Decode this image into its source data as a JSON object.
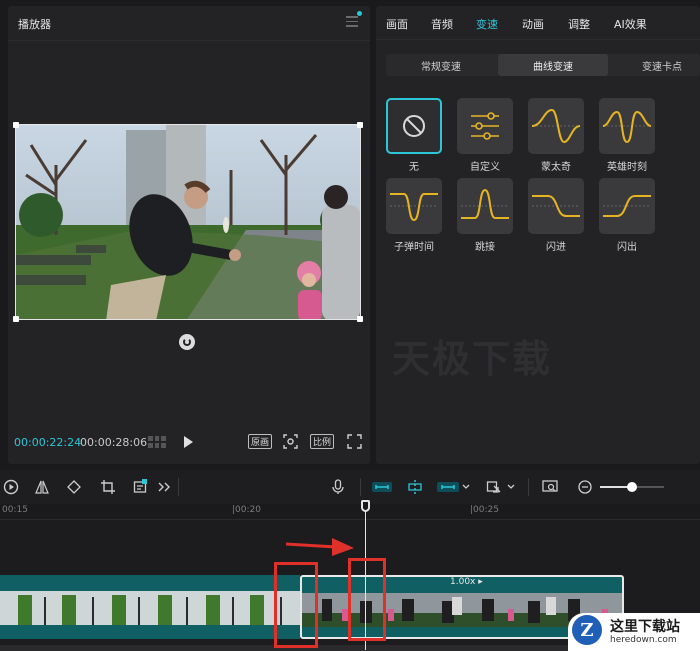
{
  "player": {
    "title": "播放器",
    "time_current": "00:00:22:24",
    "time_total": "00:00:28:06",
    "btn_fullframe": "原画",
    "btn_ratio": "比例"
  },
  "right_panel": {
    "tabs": [
      "画面",
      "音频",
      "变速",
      "动画",
      "调整",
      "AI效果"
    ],
    "active_tab": "变速",
    "subtabs": [
      "常规变速",
      "曲线变速",
      "变速卡点"
    ],
    "active_subtab": "曲线变速",
    "curves": [
      {
        "label": "无",
        "icon": "none-icon"
      },
      {
        "label": "自定义",
        "icon": "custom-sliders-icon"
      },
      {
        "label": "蒙太奇",
        "icon": "montage-curve-icon"
      },
      {
        "label": "英雄时刻",
        "icon": "hero-moment-curve-icon"
      },
      {
        "label": "子弹时间",
        "icon": "bullet-time-curve-icon"
      },
      {
        "label": "跳接",
        "icon": "jump-cut-curve-icon"
      },
      {
        "label": "闪进",
        "icon": "flash-in-curve-icon"
      },
      {
        "label": "闪出",
        "icon": "flash-out-curve-icon"
      }
    ],
    "watermark": "天极下载"
  },
  "timeline": {
    "ruler": [
      "00:15",
      "|00:20",
      "|00:25"
    ],
    "speed_badge": "1.00x ▸"
  },
  "logo": {
    "letter": "Z",
    "cn": "这里下载站",
    "en": "heredown.com"
  },
  "colors": {
    "accent": "#2dc6d8",
    "curve": "#e6b422",
    "clip": "#0f5f63",
    "highlight": "#e0302a"
  }
}
